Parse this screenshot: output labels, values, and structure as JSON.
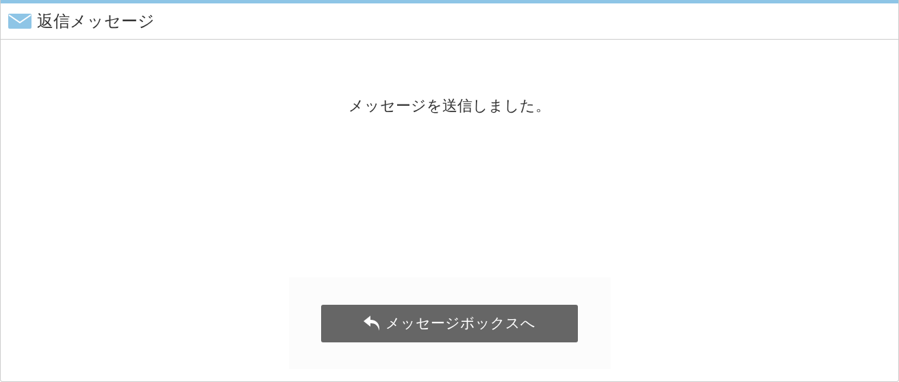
{
  "panel": {
    "title": "返信メッセージ"
  },
  "message": "メッセージを送信しました。",
  "buttons": [
    {
      "label": "メッセージボックスへ"
    }
  ]
}
